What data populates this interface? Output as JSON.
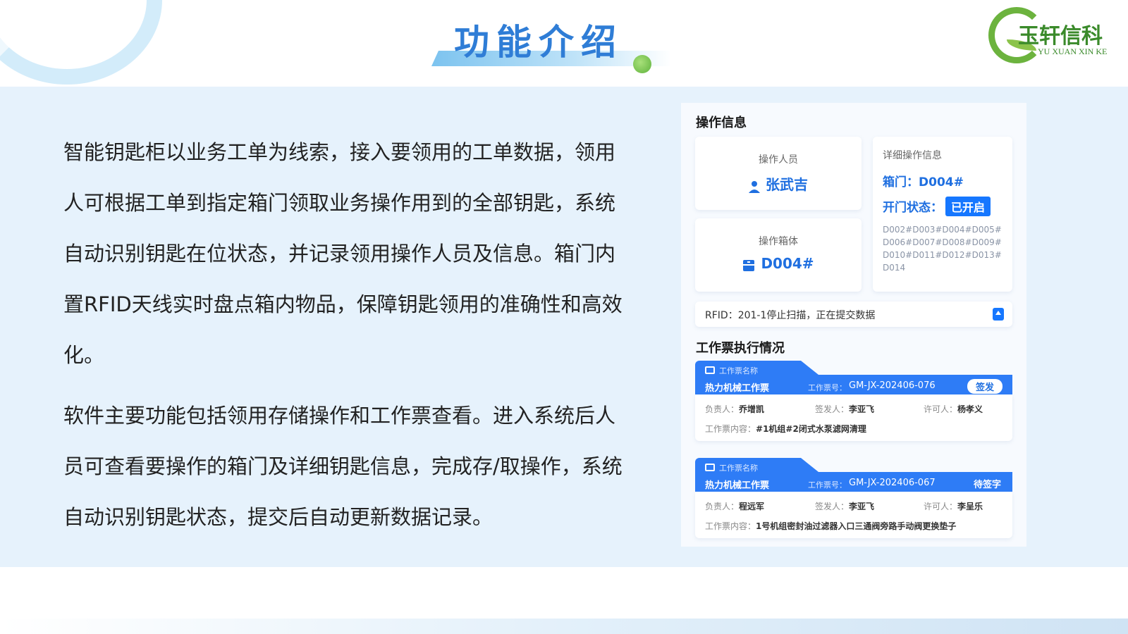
{
  "header": {
    "title": "功能介绍",
    "logo": {
      "cn": "玉轩信科",
      "en": "YU XUAN XIN KE"
    }
  },
  "intro": {
    "para1": "智能钥匙柜以业务工单为线索，接入要领用的工单数据，领用人可根据工单到指定箱门领取业务操作用到的全部钥匙，系统自动识别钥匙在位状态，并记录领用操作人员及信息。箱门内置RFID天线实时盘点箱内物品，保障钥匙领用的准确性和高效化。",
    "para2": "软件主要功能包括领用存储操作和工作票查看。进入系统后人员可查看要操作的箱门及详细钥匙信息，完成存/取操作，系统自动识别钥匙状态，提交后自动更新数据记录。"
  },
  "op_info": {
    "section_title": "操作信息",
    "operator_label": "操作人员",
    "operator_name": "张武吉",
    "box_label": "操作箱体",
    "box_value": "D004#",
    "detail": {
      "title": "详细操作信息",
      "door_label": "箱门：",
      "door_value": "D004#",
      "status_label": "开门状态：",
      "status_value": "已开启",
      "keys": "D002#D003#D004#D005#D006#D007#D008#D009#D010#D011#D012#D013#D014"
    },
    "rfid_text": "RFID：201-1停止扫描，正在提交数据"
  },
  "tickets": {
    "section_title": "工作票执行情况",
    "name_label": "工作票名称",
    "no_label": "工作票号：",
    "leader_label": "负责人：",
    "issuer_label": "签发人：",
    "permit_label": "许可人：",
    "content_label": "工作票内容：",
    "items": [
      {
        "name": "热力机械工作票",
        "no": "GM-JX-202406-076",
        "status": "签发",
        "leader": "乔增凯",
        "issuer": "李亚飞",
        "permit": "杨孝义",
        "content": "#1机组#2闭式水泵滤网清理"
      },
      {
        "name": "热力机械工作票",
        "no": "GM-JX-202406-067",
        "status": "待签字",
        "leader": "程远军",
        "issuer": "李亚飞",
        "permit": "李呈乐",
        "content": "1号机组密封油过滤器入口三通阀旁路手动阀更换垫子"
      }
    ]
  }
}
